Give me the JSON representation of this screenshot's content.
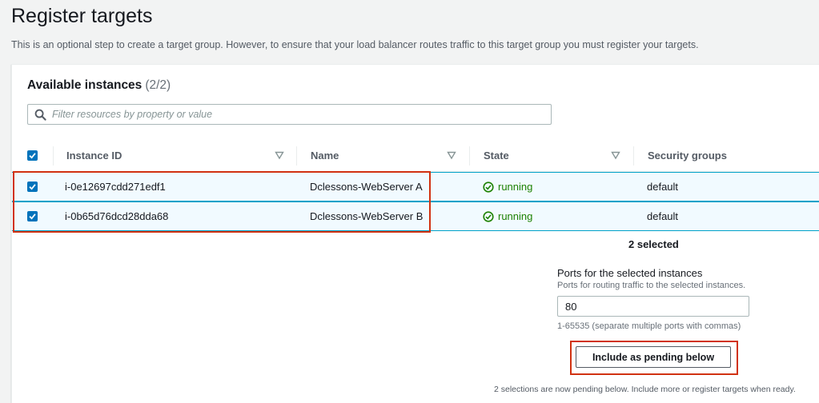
{
  "page": {
    "title": "Register targets",
    "description": "This is an optional step to create a target group. However, to ensure that your load balancer routes traffic to this target group you must register your targets."
  },
  "panel": {
    "heading": "Available instances",
    "count": "(2/2)",
    "filter": {
      "placeholder": "Filter resources by property or value",
      "value": ""
    }
  },
  "table": {
    "columns": [
      "Instance ID",
      "Name",
      "State",
      "Security groups"
    ],
    "rows": [
      {
        "selected": true,
        "instance_id": "i-0e12697cdd271edf1",
        "name": "Dclessons-WebServer A",
        "state": "running",
        "security_group": "default"
      },
      {
        "selected": true,
        "instance_id": "i-0b65d76dcd28dda68",
        "name": "Dclessons-WebServer B",
        "state": "running",
        "security_group": "default"
      }
    ],
    "select_all_checked": true
  },
  "selection": {
    "count_text": "2 selected",
    "ports_label": "Ports for the selected instances",
    "ports_description": "Ports for routing traffic to the selected instances.",
    "ports_value": "80",
    "ports_hint": "1-65535 (separate multiple ports with commas)",
    "include_button": "Include as pending below",
    "pending_note": "2 selections are now pending below. Include more or register targets when ready."
  },
  "colors": {
    "accent": "#0073bb",
    "running": "#1d8102",
    "highlight": "#d13212",
    "row_selected_bg": "#f1faff"
  },
  "icons": {
    "filter": "search-icon",
    "sort": "sort-caret-icon",
    "state": "check-circle-icon",
    "checkbox": "checkmark-icon"
  }
}
